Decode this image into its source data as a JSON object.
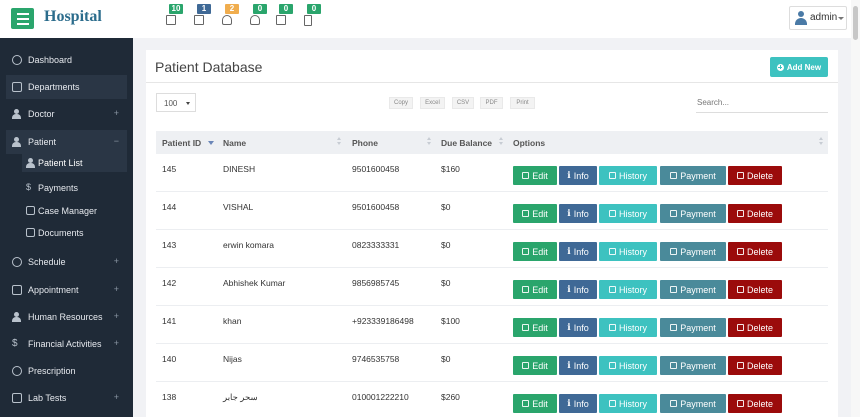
{
  "app": {
    "brand": "Hospital"
  },
  "topbar": {
    "badges": [
      {
        "count": "10",
        "color": "#2aa56c",
        "icon": "printer-icon"
      },
      {
        "count": "1",
        "color": "#3f6996",
        "icon": "money-icon"
      },
      {
        "count": "2",
        "color": "#f0ad4e",
        "icon": "user-icon"
      },
      {
        "count": "0",
        "color": "#2aa56c",
        "icon": "users-icon"
      },
      {
        "count": "0",
        "color": "#2aa56c",
        "icon": "medkit-icon"
      },
      {
        "count": "0",
        "color": "#2aa56c",
        "icon": "clipboard-icon"
      }
    ],
    "user": {
      "name": "admin"
    }
  },
  "sidebar": {
    "items": [
      {
        "label": "Dashboard",
        "plus": ""
      },
      {
        "label": "Departments",
        "plus": ""
      },
      {
        "label": "Doctor",
        "plus": "+"
      },
      {
        "label": "Patient",
        "plus": "−"
      },
      {
        "label": "Schedule",
        "plus": "+"
      },
      {
        "label": "Appointment",
        "plus": "+"
      },
      {
        "label": "Human Resources",
        "plus": "+"
      },
      {
        "label": "Financial Activities",
        "plus": "+"
      },
      {
        "label": "Prescription",
        "plus": ""
      },
      {
        "label": "Lab Tests",
        "plus": "+"
      }
    ],
    "patient_sub": [
      {
        "label": "Patient List"
      },
      {
        "label": "Payments"
      },
      {
        "label": "Case Manager"
      },
      {
        "label": "Documents"
      }
    ]
  },
  "main": {
    "title": "Patient Database",
    "add_button": "Add New",
    "page_length": "100",
    "export_buttons": [
      "Copy",
      "Excel",
      "CSV",
      "PDF",
      "Print"
    ],
    "search_placeholder": "Search...",
    "columns": [
      "Patient ID",
      "Name",
      "Phone",
      "Due Balance",
      "Options"
    ],
    "actions": {
      "edit": "Edit",
      "info": "Info",
      "history": "History",
      "payment": "Payment",
      "delete": "Delete"
    },
    "rows": [
      {
        "id": "145",
        "name": "DINESH",
        "phone": "9501600458",
        "due": "$160"
      },
      {
        "id": "144",
        "name": "VISHAL",
        "phone": "9501600458",
        "due": "$0"
      },
      {
        "id": "143",
        "name": "erwin komara",
        "phone": "0823333331",
        "due": "$0"
      },
      {
        "id": "142",
        "name": "Abhishek Kumar",
        "phone": "9856985745",
        "due": "$0"
      },
      {
        "id": "141",
        "name": "khan",
        "phone": "+923339186498",
        "due": "$100"
      },
      {
        "id": "140",
        "name": "Nijas",
        "phone": "9746535758",
        "due": "$0"
      },
      {
        "id": "138",
        "name": "سحر جابر",
        "phone": "010001222210",
        "due": "$260"
      }
    ]
  }
}
